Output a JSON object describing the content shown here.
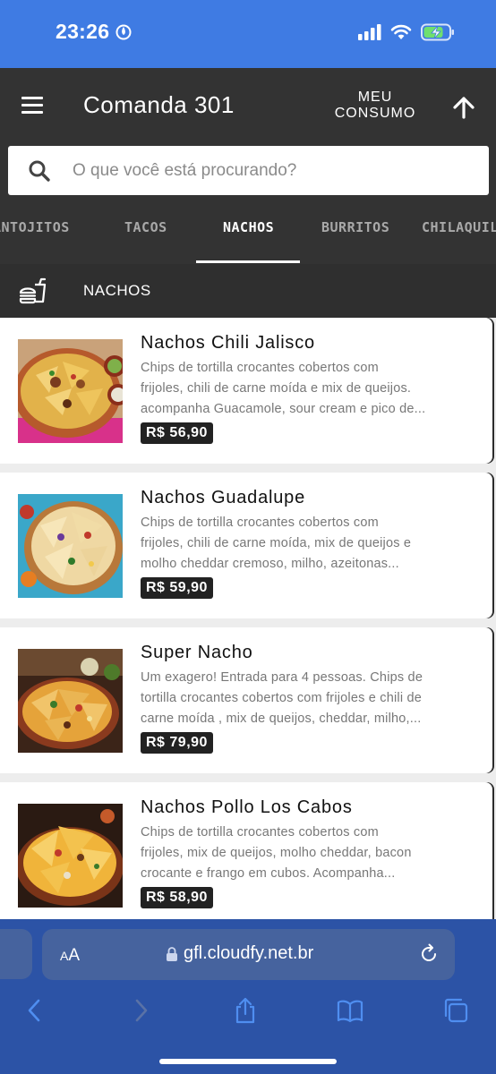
{
  "status_bar": {
    "time": "23:26",
    "colors": {
      "background": "#3f7be3",
      "battery_charge": "#6fe06f"
    }
  },
  "header": {
    "title": "Comanda 301",
    "meu_consumo_line1": "MEU",
    "meu_consumo_line2": "CONSUMO"
  },
  "search": {
    "placeholder": "O que você está procurando?"
  },
  "tabs": [
    {
      "label": "ANTOJITOS",
      "active": false
    },
    {
      "label": "TACOS",
      "active": false
    },
    {
      "label": "NACHOS",
      "active": true
    },
    {
      "label": "BURRITOS",
      "active": false
    },
    {
      "label": "CHILAQUILES",
      "active": false
    }
  ],
  "section": {
    "title": "NACHOS",
    "icon": "fastfood-icon"
  },
  "items": [
    {
      "name": "Nachos Chili Jalisco",
      "desc": [
        "Chips de tortilla crocantes cobertos com",
        "frijoles, chili de carne moída e mix de queijos.",
        "acompanha Guacamole, sour cream e pico de..."
      ],
      "price": "R$ 56,90"
    },
    {
      "name": "Nachos Guadalupe",
      "desc": [
        "Chips de tortilla crocantes cobertos com",
        "frijoles, chili de carne moída, mix de queijos e",
        "molho cheddar cremoso, milho, azeitonas..."
      ],
      "price": "R$ 59,90"
    },
    {
      "name": "Super Nacho",
      "desc": [
        "Um exagero! Entrada para 4 pessoas. Chips de",
        "tortilla crocantes cobertos com frijoles e chili de",
        "carne moída , mix de queijos, cheddar, milho,..."
      ],
      "price": "R$ 79,90"
    },
    {
      "name": "Nachos Pollo Los Cabos",
      "desc": [
        "Chips de tortilla crocantes cobertos com",
        "frijoles, mix de queijos, molho cheddar, bacon",
        "crocante e frango em cubos. Acompanha..."
      ],
      "price": "R$ 58,90"
    }
  ],
  "browser": {
    "aa_small": "A",
    "aa_large": "A",
    "url": "gfl.cloudfy.net.br",
    "colors": {
      "bar": "#2c53a6",
      "field": "#46639e"
    },
    "toolbar": [
      "back-icon",
      "forward-icon",
      "share-icon",
      "bookmarks-icon",
      "tabs-icon"
    ]
  }
}
